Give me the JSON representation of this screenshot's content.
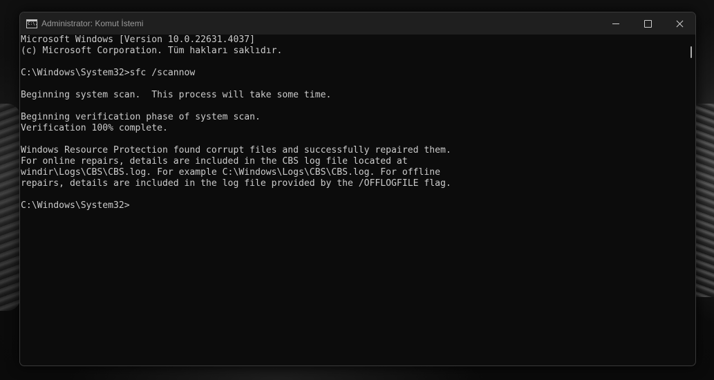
{
  "window": {
    "title": "Administrator: Komut İstemi",
    "icon": "cmd-icon",
    "icon_text": "C:\\."
  },
  "controls": {
    "minimize": "minimize-icon",
    "maximize": "maximize-icon",
    "close": "close-icon"
  },
  "console": {
    "lines": [
      "Microsoft Windows [Version 10.0.22631.4037]",
      "(c) Microsoft Corporation. Tüm hakları saklıdır.",
      "",
      "C:\\Windows\\System32>sfc /scannow",
      "",
      "Beginning system scan.  This process will take some time.",
      "",
      "Beginning verification phase of system scan.",
      "Verification 100% complete.",
      "",
      "Windows Resource Protection found corrupt files and successfully repaired them.",
      "For online repairs, details are included in the CBS log file located at",
      "windir\\Logs\\CBS\\CBS.log. For example C:\\Windows\\Logs\\CBS\\CBS.log. For offline",
      "repairs, details are included in the log file provided by the /OFFLOGFILE flag.",
      "",
      "C:\\Windows\\System32>"
    ]
  },
  "colors": {
    "console_bg": "#0c0c0c",
    "console_text": "#cccccc",
    "titlebar_bg": "#1f1f1f"
  }
}
